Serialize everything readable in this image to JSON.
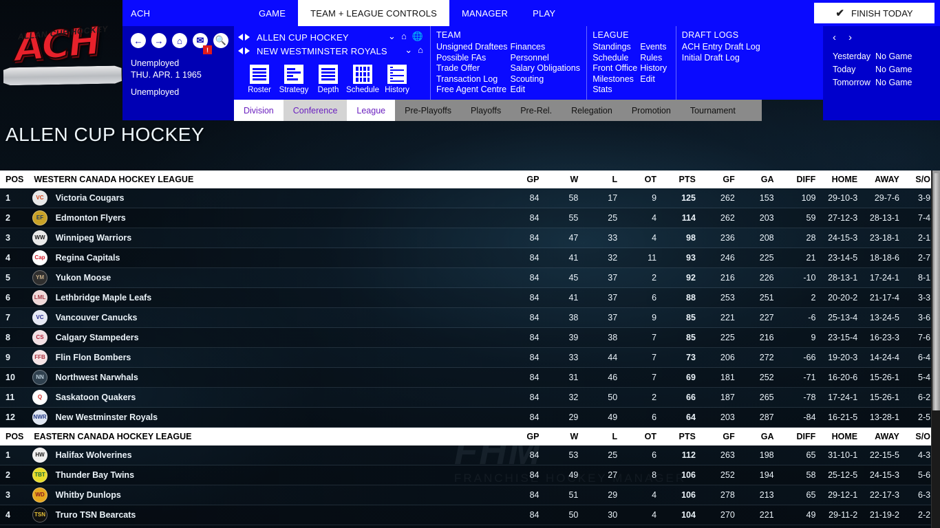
{
  "logo": {
    "main": "ACH",
    "banner": "ALLAN CUP HOCKEY"
  },
  "topbar": {
    "app_label": "ACH",
    "tabs": [
      {
        "label": "GAME",
        "active": false
      },
      {
        "label": "TEAM + LEAGUE CONTROLS",
        "active": true
      },
      {
        "label": "MANAGER",
        "active": false
      },
      {
        "label": "PLAY",
        "active": false
      }
    ],
    "finish_today": "FINISH TODAY",
    "check_icon": "check-icon"
  },
  "navblock": {
    "icons": [
      "back-arrow-icon",
      "forward-arrow-icon",
      "home-icon",
      "mail-icon",
      "search-icon"
    ],
    "mail_badge": "!",
    "status": "Unemployed",
    "date": "THU. APR. 1 1965",
    "role": "Unemployed"
  },
  "menupanel": {
    "league_selector": "ALLEN CUP HOCKEY",
    "team_selector": "NEW WESTMINSTER ROYALS",
    "quick_links": [
      {
        "label": "Roster",
        "icon": "list-icon"
      },
      {
        "label": "Strategy",
        "icon": "strategy-icon"
      },
      {
        "label": "Depth",
        "icon": "depth-icon"
      },
      {
        "label": "Schedule",
        "icon": "calendar-icon"
      },
      {
        "label": "History",
        "icon": "history-icon"
      }
    ],
    "team": {
      "heading": "TEAM",
      "col1": [
        "Unsigned Draftees",
        "Possible FAs",
        "Trade Offer",
        "Transaction Log",
        "Free Agent Centre"
      ],
      "col2": [
        "Finances",
        "Personnel",
        "Salary Obligations",
        "Scouting",
        "Edit"
      ]
    },
    "league": {
      "heading": "LEAGUE",
      "col1": [
        "Standings",
        "Schedule",
        "Front Office",
        "Milestones",
        "Stats"
      ],
      "col2": [
        "Events",
        "Rules",
        "History",
        "Edit"
      ]
    },
    "draft": {
      "heading": "DRAFT LOGS",
      "links": [
        "ACH Entry Draft Log",
        "Initial Draft Log"
      ]
    }
  },
  "schedule_panel": {
    "prev": "‹",
    "next": "›",
    "rows": [
      {
        "day": "Yesterday",
        "game": "No Game"
      },
      {
        "day": "Today",
        "game": "No Game"
      },
      {
        "day": "Tomorrow",
        "game": "No Game"
      }
    ]
  },
  "subtabs": [
    {
      "label": "Division",
      "style": "white"
    },
    {
      "label": "Conference",
      "style": "grey-light"
    },
    {
      "label": "League",
      "style": "white"
    },
    {
      "label": "Pre-Playoffs",
      "style": "grey"
    },
    {
      "label": "Playoffs",
      "style": "grey"
    },
    {
      "label": "Pre-Rel.",
      "style": "grey"
    },
    {
      "label": "Relegation",
      "style": "grey"
    },
    {
      "label": "Promotion",
      "style": "grey"
    },
    {
      "label": "Tournament",
      "style": "grey"
    }
  ],
  "page_title": "ALLEN CUP HOCKEY",
  "watermark": {
    "big": "FHM",
    "small": "FRANCHISE HOCKEY MANAGER"
  },
  "standings": {
    "columns": [
      "POS",
      "GP",
      "W",
      "L",
      "OT",
      "PTS",
      "GF",
      "GA",
      "DIFF",
      "HOME",
      "AWAY",
      "S/O"
    ],
    "sections": [
      {
        "title": "WESTERN CANADA HOCKEY LEAGUE",
        "rows": [
          {
            "pos": "1",
            "team": "Victoria Cougars",
            "gp": "84",
            "w": "58",
            "l": "17",
            "ot": "9",
            "pts": "125",
            "gf": "262",
            "ga": "153",
            "diff": "109",
            "home": "29-10-3",
            "away": "29-7-6",
            "so": "3-9",
            "logo_bg": "#e8e8e8",
            "logo_fg": "#d64a1e",
            "logo_text": "VC"
          },
          {
            "pos": "2",
            "team": "Edmonton Flyers",
            "gp": "84",
            "w": "55",
            "l": "25",
            "ot": "4",
            "pts": "114",
            "gf": "262",
            "ga": "203",
            "diff": "59",
            "home": "27-12-3",
            "away": "28-13-1",
            "so": "7-4",
            "logo_bg": "#c9a227",
            "logo_fg": "#1c3a63",
            "logo_text": "EF"
          },
          {
            "pos": "3",
            "team": "Winnipeg Warriors",
            "gp": "84",
            "w": "47",
            "l": "33",
            "ot": "4",
            "pts": "98",
            "gf": "236",
            "ga": "208",
            "diff": "28",
            "home": "24-15-3",
            "away": "23-18-1",
            "so": "2-1",
            "logo_bg": "#e9e9e9",
            "logo_fg": "#1a1a1a",
            "logo_text": "WW"
          },
          {
            "pos": "4",
            "team": "Regina Capitals",
            "gp": "84",
            "w": "41",
            "l": "32",
            "ot": "11",
            "pts": "93",
            "gf": "246",
            "ga": "225",
            "diff": "21",
            "home": "23-14-5",
            "away": "18-18-6",
            "so": "2-7",
            "logo_bg": "#ffffff",
            "logo_fg": "#d41f2c",
            "logo_text": "Cap"
          },
          {
            "pos": "5",
            "team": "Yukon Moose",
            "gp": "84",
            "w": "45",
            "l": "37",
            "ot": "2",
            "pts": "92",
            "gf": "216",
            "ga": "226",
            "diff": "-10",
            "home": "28-13-1",
            "away": "17-24-1",
            "so": "8-1",
            "logo_bg": "#2f2f2f",
            "logo_fg": "#c8b08a",
            "logo_text": "YM"
          },
          {
            "pos": "6",
            "team": "Lethbridge Maple Leafs",
            "gp": "84",
            "w": "41",
            "l": "37",
            "ot": "6",
            "pts": "88",
            "gf": "253",
            "ga": "251",
            "diff": "2",
            "home": "20-20-2",
            "away": "21-17-4",
            "so": "3-3",
            "logo_bg": "#f0d8d8",
            "logo_fg": "#a43b47",
            "logo_text": "LML"
          },
          {
            "pos": "7",
            "team": "Vancouver Canucks",
            "gp": "84",
            "w": "38",
            "l": "37",
            "ot": "9",
            "pts": "85",
            "gf": "221",
            "ga": "227",
            "diff": "-6",
            "home": "25-13-4",
            "away": "13-24-5",
            "so": "3-6",
            "logo_bg": "#e6e9f5",
            "logo_fg": "#2b2f8f",
            "logo_text": "VC"
          },
          {
            "pos": "8",
            "team": "Calgary Stampeders",
            "gp": "84",
            "w": "39",
            "l": "38",
            "ot": "7",
            "pts": "85",
            "gf": "225",
            "ga": "216",
            "diff": "9",
            "home": "23-15-4",
            "away": "16-23-3",
            "so": "7-6",
            "logo_bg": "#f2dfe3",
            "logo_fg": "#b2243a",
            "logo_text": "CS"
          },
          {
            "pos": "9",
            "team": "Flin Flon Bombers",
            "gp": "84",
            "w": "33",
            "l": "44",
            "ot": "7",
            "pts": "73",
            "gf": "206",
            "ga": "272",
            "diff": "-66",
            "home": "19-20-3",
            "away": "14-24-4",
            "so": "6-4",
            "logo_bg": "#f6e4e6",
            "logo_fg": "#a9323f",
            "logo_text": "FFB"
          },
          {
            "pos": "10",
            "team": "Northwest Narwhals",
            "gp": "84",
            "w": "31",
            "l": "46",
            "ot": "7",
            "pts": "69",
            "gf": "181",
            "ga": "252",
            "diff": "-71",
            "home": "16-20-6",
            "away": "15-26-1",
            "so": "5-4",
            "logo_bg": "#30414f",
            "logo_fg": "#b9cbd8",
            "logo_text": "NN"
          },
          {
            "pos": "11",
            "team": "Saskatoon Quakers",
            "gp": "84",
            "w": "32",
            "l": "50",
            "ot": "2",
            "pts": "66",
            "gf": "187",
            "ga": "265",
            "diff": "-78",
            "home": "17-24-1",
            "away": "15-26-1",
            "so": "6-2",
            "logo_bg": "#ffffff",
            "logo_fg": "#d1322c",
            "logo_text": "Q"
          },
          {
            "pos": "12",
            "team": "New Westminster Royals",
            "gp": "84",
            "w": "29",
            "l": "49",
            "ot": "6",
            "pts": "64",
            "gf": "203",
            "ga": "287",
            "diff": "-84",
            "home": "16-21-5",
            "away": "13-28-1",
            "so": "2-5",
            "logo_bg": "#dfe6f2",
            "logo_fg": "#253b86",
            "logo_text": "NWR"
          }
        ]
      },
      {
        "title": "EASTERN CANADA HOCKEY LEAGUE",
        "rows": [
          {
            "pos": "1",
            "team": "Halifax Wolverines",
            "gp": "84",
            "w": "53",
            "l": "25",
            "ot": "6",
            "pts": "112",
            "gf": "263",
            "ga": "198",
            "diff": "65",
            "home": "31-10-1",
            "away": "22-15-5",
            "so": "4-3",
            "logo_bg": "#efefef",
            "logo_fg": "#1d1d1d",
            "logo_text": "HW"
          },
          {
            "pos": "2",
            "team": "Thunder Bay Twins",
            "gp": "84",
            "w": "49",
            "l": "27",
            "ot": "8",
            "pts": "106",
            "gf": "252",
            "ga": "194",
            "diff": "58",
            "home": "25-12-5",
            "away": "24-15-3",
            "so": "5-6",
            "logo_bg": "#e8dc2a",
            "logo_fg": "#1f6f3a",
            "logo_text": "TBT"
          },
          {
            "pos": "3",
            "team": "Whitby Dunlops",
            "gp": "84",
            "w": "51",
            "l": "29",
            "ot": "4",
            "pts": "106",
            "gf": "278",
            "ga": "213",
            "diff": "65",
            "home": "29-12-1",
            "away": "22-17-3",
            "so": "6-3",
            "logo_bg": "#e6a81e",
            "logo_fg": "#8c1b22",
            "logo_text": "WD"
          },
          {
            "pos": "4",
            "team": "Truro TSN Bearcats",
            "gp": "84",
            "w": "50",
            "l": "30",
            "ot": "4",
            "pts": "104",
            "gf": "270",
            "ga": "221",
            "diff": "49",
            "home": "29-11-2",
            "away": "21-19-2",
            "so": "2-2",
            "logo_bg": "#111111",
            "logo_fg": "#e8c33a",
            "logo_text": "TSN"
          }
        ]
      }
    ]
  }
}
